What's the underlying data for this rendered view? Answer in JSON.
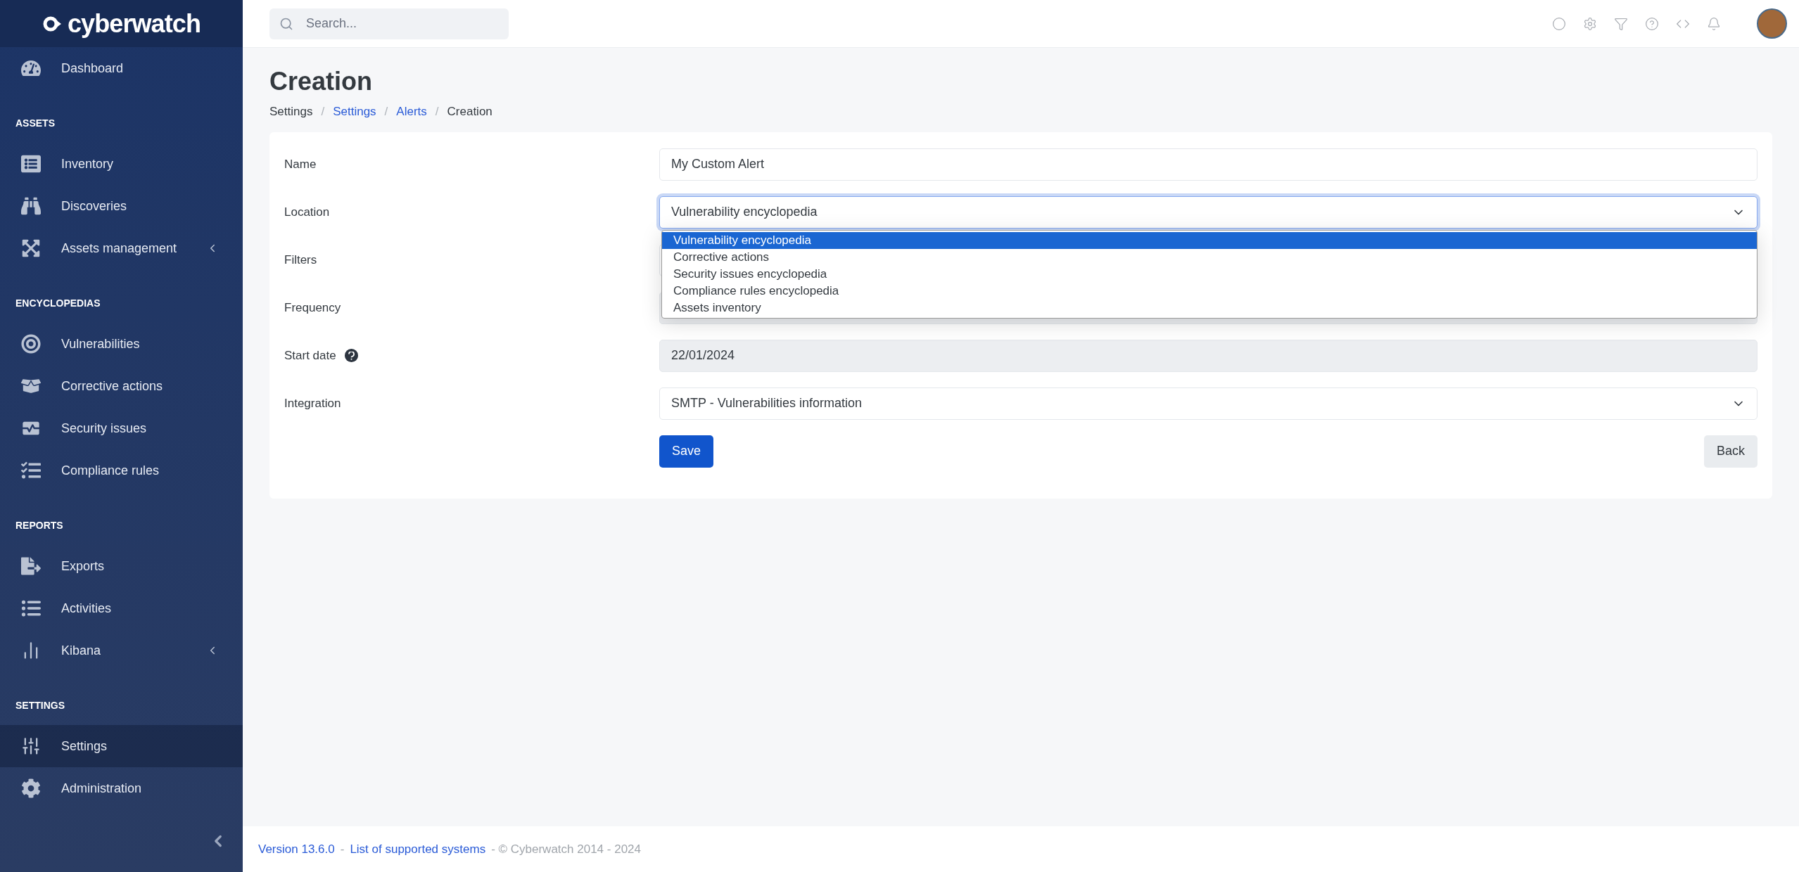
{
  "sidebar": {
    "logo": "cyberwatch",
    "sections": [
      {
        "items": [
          {
            "label": "Dashboard",
            "selected": false,
            "has_submenu": false
          }
        ]
      },
      {
        "title": "ASSETS",
        "items": [
          {
            "label": "Inventory",
            "selected": false,
            "has_submenu": false
          },
          {
            "label": "Discoveries",
            "selected": false,
            "has_submenu": false
          },
          {
            "label": "Assets management",
            "selected": false,
            "has_submenu": true
          }
        ]
      },
      {
        "title": "ENCYCLOPEDIAS",
        "items": [
          {
            "label": "Vulnerabilities",
            "selected": false,
            "has_submenu": false
          },
          {
            "label": "Corrective actions",
            "selected": false,
            "has_submenu": false
          },
          {
            "label": "Security issues",
            "selected": false,
            "has_submenu": false
          },
          {
            "label": "Compliance rules",
            "selected": false,
            "has_submenu": false
          }
        ]
      },
      {
        "title": "REPORTS",
        "items": [
          {
            "label": "Exports",
            "selected": false,
            "has_submenu": false
          },
          {
            "label": "Activities",
            "selected": false,
            "has_submenu": false
          },
          {
            "label": "Kibana",
            "selected": false,
            "has_submenu": true
          }
        ]
      },
      {
        "title": "SETTINGS",
        "items": [
          {
            "label": "Settings",
            "selected": true,
            "has_submenu": false
          },
          {
            "label": "Administration",
            "selected": false,
            "has_submenu": false
          }
        ]
      }
    ]
  },
  "header": {
    "search": {
      "placeholder": "Search..."
    }
  },
  "page": {
    "title": "Creation",
    "breadcrumbs": [
      {
        "label": "Settings",
        "link": false
      },
      {
        "separator": "/",
        "label": "Settings",
        "link": true
      },
      {
        "separator": "/",
        "label": "Alerts",
        "link": true
      },
      {
        "separator": "/",
        "label": "Creation",
        "link": false
      }
    ]
  },
  "form": {
    "fields": [
      {
        "label": "Name",
        "kind": "text",
        "value": "My Custom Alert",
        "disabled": false,
        "help": false
      },
      {
        "label": "Location",
        "kind": "select",
        "value": "Vulnerability encyclopedia",
        "disabled": false,
        "help": false,
        "expanded": true,
        "options": [
          {
            "label": "Vulnerability encyclopedia",
            "selected": true
          },
          {
            "label": "Corrective actions",
            "selected": false
          },
          {
            "label": "Security issues encyclopedia",
            "selected": false
          },
          {
            "label": "Compliance rules encyclopedia",
            "selected": false
          },
          {
            "label": "Assets inventory",
            "selected": false
          }
        ]
      },
      {
        "label": "Filters",
        "kind": "text",
        "disabled": false,
        "help": false
      },
      {
        "label": "Frequency",
        "kind": "text",
        "disabled": true,
        "help": false
      },
      {
        "label": "Start date",
        "kind": "text",
        "value": "22/01/2024",
        "disabled": true,
        "help": true
      },
      {
        "label": "Integration",
        "kind": "select",
        "value": "SMTP - Vulnerabilities information",
        "disabled": false,
        "help": false,
        "expanded": false
      }
    ],
    "buttons": [
      {
        "label": "Save",
        "kind": "primary"
      },
      {
        "label": "Back",
        "kind": "secondary"
      }
    ]
  },
  "footer": {
    "version": "Version 13.6.0",
    "separator_1": "-",
    "link": "List of supported systems",
    "copyright": "- © Cyberwatch 2014 - 2024"
  }
}
